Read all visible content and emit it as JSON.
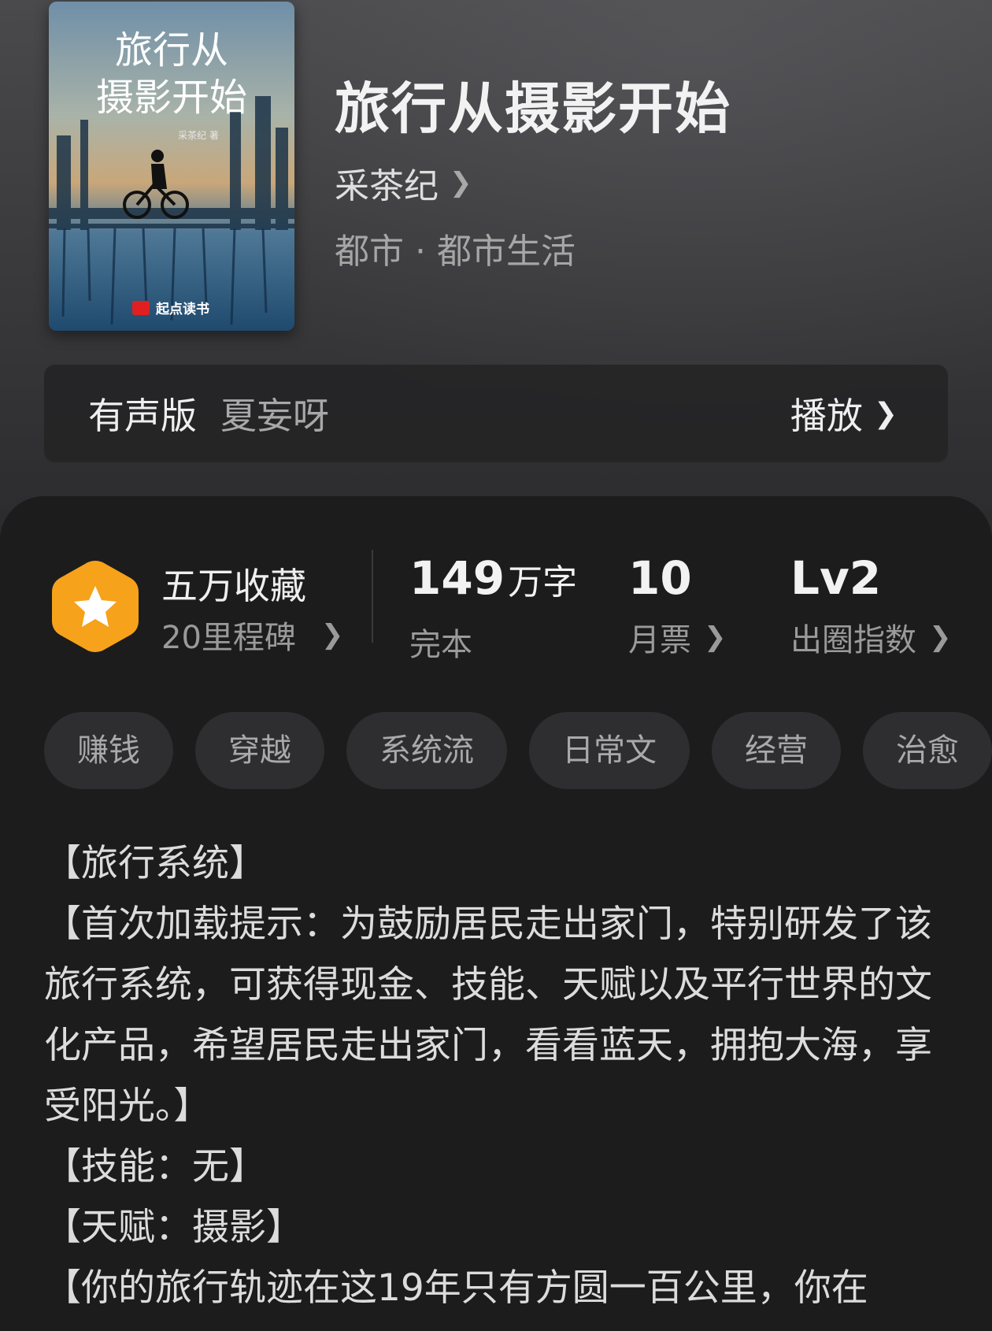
{
  "book": {
    "title": "旅行从摄影开始",
    "author": "采茶纪",
    "genre": "都市 · 都市生活",
    "cover": {
      "title_line1": "旅行从",
      "title_line2": "摄影开始",
      "author_small": "采茶纪 著",
      "publisher": "起点读书"
    }
  },
  "audio": {
    "label": "有声版",
    "narrator": "夏妄呀",
    "play": "播放"
  },
  "stats": {
    "favorites": {
      "title": "五万收藏",
      "sub": "20里程碑"
    },
    "words": {
      "value": "149",
      "unit": "万字",
      "label": "完本"
    },
    "monthly": {
      "value": "10",
      "label": "月票"
    },
    "level": {
      "value": "Lv2",
      "label": "出圈指数"
    }
  },
  "tags": [
    "赚钱",
    "穿越",
    "系统流",
    "日常文",
    "经营",
    "治愈"
  ],
  "description": [
    "【旅行系统】",
    "【首次加载提示：为鼓励居民走出家门，特别研发了该旅行系统，可获得现金、技能、天赋以及平行世界的文化产品，希望居民走出家门，看看蓝天，拥抱大海，享受阳光。】",
    "【技能：无】",
    "【天赋：摄影】",
    "【你的旅行轨迹在这19年只有方圆一百公里，你在"
  ],
  "colors": {
    "badge_orange": "#f7a21b",
    "panel_bg": "#1c1c1d",
    "tag_bg": "#2e2e30"
  }
}
